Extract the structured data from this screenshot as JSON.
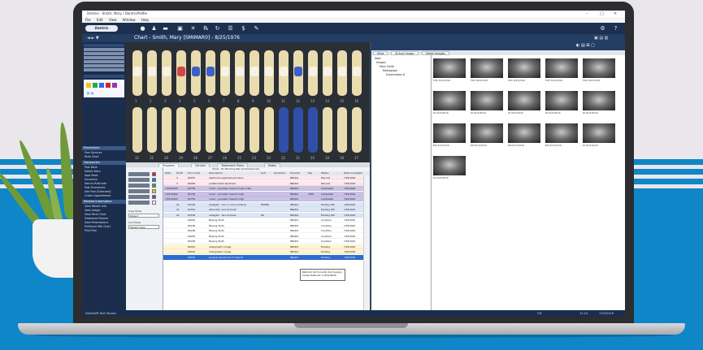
{
  "colors": {
    "background_blue": "#0f86c7",
    "app_navy": "#1b2d4d",
    "accent_blue": "#3c5fc9"
  },
  "window": {
    "title": "Dentrix - Smith, Mary / DentrixProfile",
    "minimize_icon": "minimize-icon",
    "maximize_icon": "maximize-icon",
    "close_icon": "close-icon"
  },
  "menu": [
    "File",
    "Edit",
    "View",
    "Window",
    "Help"
  ],
  "toolbar": {
    "logo": "Dentrix",
    "icons": [
      "user-icon",
      "family-icon",
      "folder-icon",
      "print-icon",
      "tools-icon",
      "prescription-icon",
      "refresh-icon",
      "ledger-icon",
      "dollar-icon",
      "chart-icon"
    ]
  },
  "patient_bar": {
    "title": "Chart - Smith, Mary [SMIMAR0] - 8/25/1976",
    "right_label": "Chart"
  },
  "left_nav": {
    "sections": [
      "Procedures",
      "Transaction",
      "Related Information"
    ],
    "procedure_items": [
      "Prev Services",
      "Perio Chart"
    ],
    "transaction_items": [
      "Post Work",
      "Delete Work",
      "Appt Book",
      "Insurance",
      "Add to Multicode",
      "Post Procedures",
      "Add Plan (Extended)",
      "Create Appointment"
    ],
    "related_items": [
      "View Patient Info",
      "View Ledger",
      "View Perio Chart",
      "Treatment Planner",
      "View Prescriptions",
      "Preferred Hlth Chart",
      "Print Plan"
    ],
    "footer": "DentalVR Test Version"
  },
  "chart": {
    "upper_numbers": [
      "1",
      "2",
      "3",
      "4",
      "5",
      "6",
      "7",
      "8",
      "9",
      "10",
      "11",
      "12",
      "13",
      "14",
      "15",
      "16"
    ],
    "lower_numbers": [
      "32",
      "31",
      "30",
      "29",
      "28",
      "27",
      "26",
      "25",
      "24",
      "23",
      "22",
      "21",
      "20",
      "19",
      "18",
      "17"
    ]
  },
  "tabs": [
    "Progress",
    "Clinical",
    "Treatment Plans",
    "Notes"
  ],
  "filter_panel": {
    "label_view": "View Mode",
    "select_visit": "Patient",
    "label_sort": "Sort Mode",
    "select_sort": "Patient Date",
    "filters": [
      "EX",
      "TX",
      "CO",
      "RF",
      "PR",
      "PN"
    ]
  },
  "grid": {
    "header_top": "Chart - Ex Pending Plan (Individual All)",
    "columns": [
      "Date",
      "Tooth",
      "Proc Code",
      "Description",
      "Surf",
      "Quadrant",
      "Provider",
      "Fee",
      "Status",
      "Date Complete"
    ],
    "rows": [
      [
        "",
        "3",
        "D6057",
        "abutment supported porcelain",
        "",
        "",
        "MRQ04",
        "",
        "Planned",
        "7/25/2016"
      ],
      [
        "",
        "3",
        "D6065",
        "prefabricated abutment",
        "",
        "",
        "MRQ04",
        "",
        "Planned",
        "7/25/2016"
      ],
      [
        "7/25/2016",
        "3",
        "D2750",
        "crown - porcelain fused to high noble",
        "",
        "",
        "MRQ04",
        "",
        "Completed",
        "7/25/2016"
      ],
      [
        "7/25/2016",
        "3",
        "D2750",
        "crown - porcelain fused to high",
        "",
        "",
        "MRQ04",
        "1500",
        "Completed",
        "7/25/2016"
      ],
      [
        "7/25/2016",
        "3",
        "D2750",
        "crown - porcelain fused to high",
        "",
        "",
        "MRQ04",
        "",
        "Completed",
        "7/25/2016"
      ],
      [
        "",
        "22",
        "D2330",
        "amalgam - four or more surfaces",
        "MODBL",
        "",
        "MRQ04",
        "",
        "Existing Oth",
        "7/25/2016"
      ],
      [
        "",
        "22",
        "D2391",
        "extraction coronal tooth",
        "",
        "",
        "MRQ04",
        "",
        "Existing Oth",
        "7/25/2016"
      ],
      [
        "",
        "22",
        "D2160",
        "amalgam - two surfaces",
        "DO",
        "",
        "MRQ04",
        "",
        "Existing Oth",
        "7/25/2016"
      ],
      [
        "",
        "",
        "D0290",
        "Missing Tooth",
        "",
        "",
        "MRQ04",
        "",
        "Condition",
        "7/25/2016"
      ],
      [
        "",
        "",
        "D0290",
        "Missing Tooth",
        "",
        "",
        "MRQ04",
        "",
        "Condition",
        "7/25/2016"
      ],
      [
        "",
        "",
        "D0290",
        "Missing Tooth",
        "",
        "",
        "MRQ04",
        "",
        "Condition",
        "7/25/2016"
      ],
      [
        "",
        "",
        "D0290",
        "Missing Tooth",
        "",
        "",
        "MRQ04",
        "",
        "Condition",
        "7/25/2016"
      ],
      [
        "",
        "",
        "D0290",
        "Missing Tooth",
        "",
        "",
        "MRQ04",
        "",
        "Condition",
        "7/25/2016"
      ],
      [
        "",
        "",
        "D6010",
        "radiographic image",
        "",
        "",
        "MRQ04",
        "",
        "Existing",
        "7/25/2016"
      ],
      [
        "",
        "",
        "D6010",
        "radiographic image",
        "",
        "",
        "MRQ04",
        "",
        "Existing",
        "7/25/2016"
      ],
      [
        "",
        "",
        "D6010",
        "surgical placement of implant",
        "",
        "",
        "MRQ04",
        "",
        "Existing",
        "7/25/2016"
      ]
    ],
    "tooltip": "Referred Out to Lamb Oral Surgery Center Referred on 8/22/2016"
  },
  "imaging": {
    "tabs": [
      "View",
      "Virtual Image",
      "Video Images"
    ],
    "tree": [
      "Date",
      "Images",
      "Mary Smith",
      "Radiograph",
      "Examination 8"
    ],
    "thumbnail_captions": [
      "FMX 8/22/2016",
      "FMX 8/22/2016",
      "FMX 8/22/2016",
      "FMX 8/22/2016",
      "FMX 8/22/2016",
      "PA 8/22/2016",
      "PA 8/22/2016",
      "PA 8/22/2016",
      "PA 8/22/2016",
      "PA 8/22/2016",
      "BW 8/22/2016",
      "BW 8/22/2016",
      "BW 8/22/2016",
      "BW 8/22/2016",
      "PA 8/22/2016",
      "PA 8/22/2016"
    ]
  },
  "status_bar": {
    "left": "DentalVR Test Version",
    "right_1": "OD",
    "right_2": "11:24",
    "right_3": "7/25/2016"
  }
}
